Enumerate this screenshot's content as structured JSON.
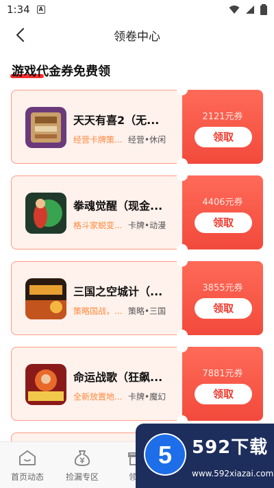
{
  "status_bar": {
    "time": "1:34",
    "app_badge": "A"
  },
  "header": {
    "title": "领卷中心"
  },
  "section": {
    "title": "游戏代金券免费领"
  },
  "coupons": [
    {
      "name": "天天有喜2（无...",
      "desc": "经营卡牌策...",
      "tags": "经营•休闲",
      "amount": "2121元券",
      "button": "领取"
    },
    {
      "name": "拳魂觉醒（现金...",
      "desc": "格斗家蜕变...",
      "tags": "卡牌•动漫",
      "amount": "4406元券",
      "button": "领取"
    },
    {
      "name": "三国之空城计（...",
      "desc": "策略国战，...",
      "tags": "策略•三国",
      "amount": "3855元券",
      "button": "领取"
    },
    {
      "name": "命运战歌（狂飙...",
      "desc": "全新放置地...",
      "tags": "卡牌•魔幻",
      "amount": "7881元券",
      "button": "领取"
    }
  ],
  "bottom_nav": {
    "tabs": [
      {
        "label": "首页动态",
        "icon": "home-icon"
      },
      {
        "label": "捡漏专区",
        "icon": "money-bag-icon"
      },
      {
        "label": "领号",
        "icon": "gift-icon"
      }
    ]
  },
  "watermark": {
    "brand": "592下载",
    "url": "www.592xiazai.com",
    "logo": "5"
  },
  "colors": {
    "accent": "#f24a3c",
    "card_bg": "#fff1ec",
    "desc_orange": "#ff8a3d"
  }
}
